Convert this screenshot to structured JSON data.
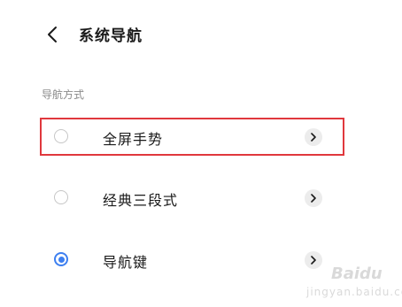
{
  "header": {
    "title": "系统导航",
    "back_icon": "chevron-left-icon"
  },
  "section": {
    "label": "导航方式"
  },
  "options": [
    {
      "label": "全屏手势",
      "checked": false,
      "highlighted": true
    },
    {
      "label": "经典三段式",
      "checked": false,
      "highlighted": false
    },
    {
      "label": "导航键",
      "checked": true,
      "highlighted": false
    }
  ],
  "colors": {
    "accent": "#3d7ff0",
    "highlight_border": "#e0383d",
    "chevron_bg": "#ececec"
  },
  "watermark": {
    "logo_text": "Baidu",
    "sub_text": "jingyan.baidu.com"
  }
}
